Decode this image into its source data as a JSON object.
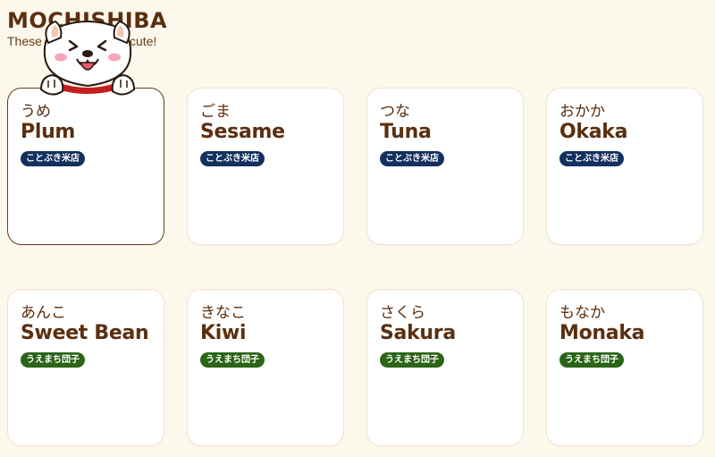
{
  "header": {
    "brand": "MOCHISHIBA",
    "tagline": "These mochi are fully cute!"
  },
  "colors": {
    "background": "#fcf8ec",
    "text_brown": "#5a2f10",
    "badge_navy": "#13305e",
    "badge_green": "#2a6417"
  },
  "mascot": {
    "icon": "shiba-dog-mascot-icon"
  },
  "cards": [
    {
      "kana": "うめ",
      "name": "Plum",
      "shop": "ことぶき米店",
      "badge_color": "#13305e"
    },
    {
      "kana": "ごま",
      "name": "Sesame",
      "shop": "ことぶき米店",
      "badge_color": "#13305e"
    },
    {
      "kana": "つな",
      "name": "Tuna",
      "shop": "ことぶき米店",
      "badge_color": "#13305e"
    },
    {
      "kana": "おかか",
      "name": "Okaka",
      "shop": "ことぶき米店",
      "badge_color": "#13305e"
    },
    {
      "kana": "あんこ",
      "name": "Sweet Bean",
      "shop": "うえまち団子",
      "badge_color": "#2a6417"
    },
    {
      "kana": "きなこ",
      "name": "Kiwi",
      "shop": "うえまち団子",
      "badge_color": "#2a6417"
    },
    {
      "kana": "さくら",
      "name": "Sakura",
      "shop": "うえまち団子",
      "badge_color": "#2a6417"
    },
    {
      "kana": "もなか",
      "name": "Monaka",
      "shop": "うえまち団子",
      "badge_color": "#2a6417"
    }
  ]
}
